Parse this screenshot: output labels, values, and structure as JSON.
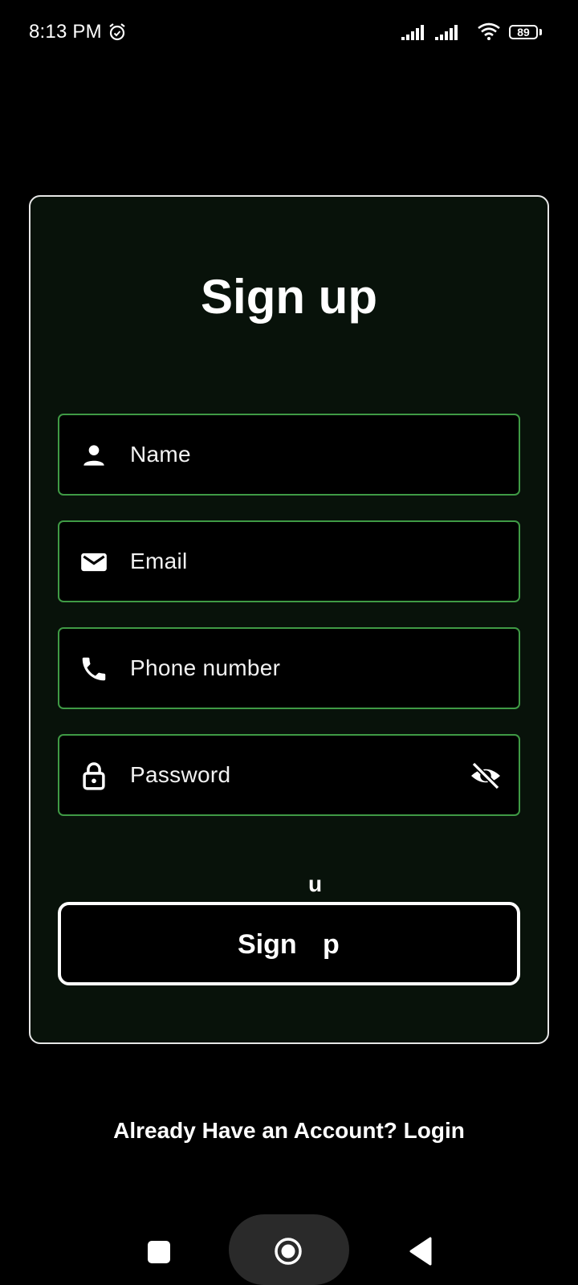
{
  "status_bar": {
    "time": "8:13 PM",
    "battery": "89",
    "icons": [
      "alarm-icon",
      "signal-icon",
      "signal-icon",
      "wifi-icon",
      "battery-icon"
    ]
  },
  "form": {
    "title": "Sign up",
    "fields": [
      {
        "label": "Name",
        "icon": "person-icon"
      },
      {
        "label": "Email",
        "icon": "mail-icon"
      },
      {
        "label": "Phone number",
        "icon": "phone-icon"
      },
      {
        "label": "Password",
        "icon": "lock-icon",
        "trailing_icon": "visibility-off-icon"
      }
    ],
    "floating_letter": "u",
    "submit_label_part1": "Sign",
    "submit_label_part2": "p"
  },
  "footer": {
    "login_prompt": "Already Have an Account? Login"
  },
  "nav": {
    "icons": [
      "recents-square-icon",
      "home-circle-icon",
      "back-triangle-icon"
    ]
  },
  "colors": {
    "background": "#000000",
    "card_background": "#08120a",
    "field_border": "#3f9a45",
    "text": "#ffffff"
  }
}
